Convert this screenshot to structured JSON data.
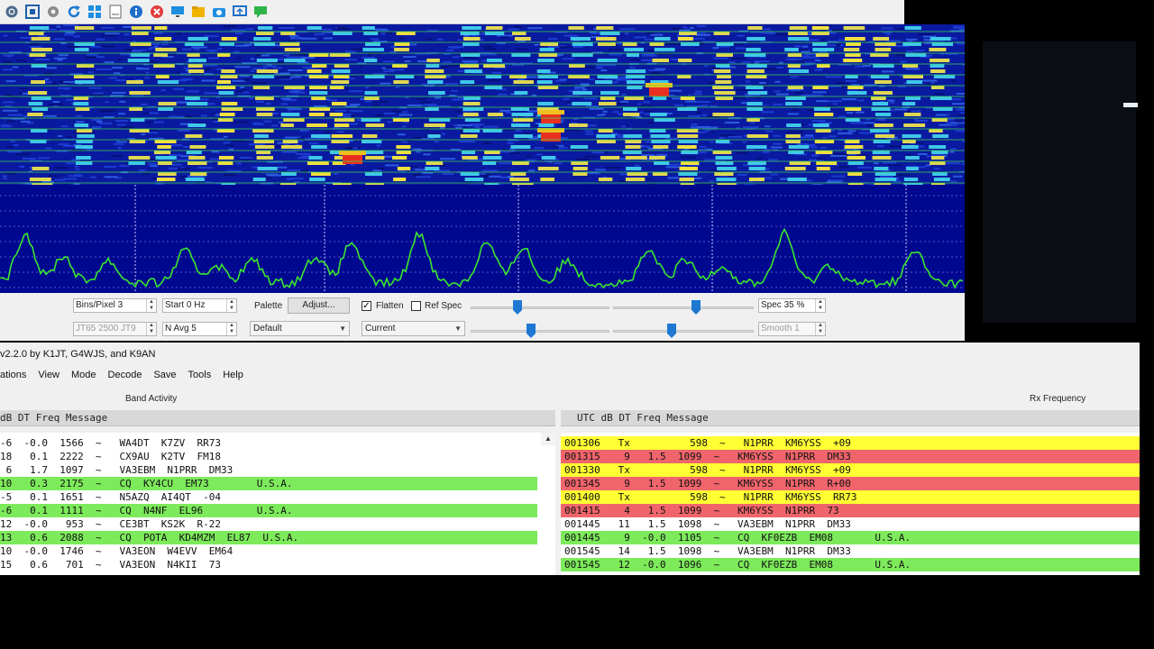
{
  "toolbar": {
    "icons": [
      "gear-network-icon",
      "expand-icon",
      "settings-icon",
      "refresh-icon",
      "windows-icon",
      "document-icon",
      "info-icon",
      "close-red-icon",
      "monitor-icon",
      "folder-icon",
      "camera-icon",
      "screen-share-icon",
      "chat-icon"
    ]
  },
  "controls": {
    "bins_pixel": "Bins/Pixel  3",
    "start": "Start 0 Hz",
    "palette_label": "Palette",
    "adjust_label": "Adjust...",
    "flatten_label": "Flatten",
    "ref_spec_label": "Ref Spec",
    "spec": "Spec 35 %",
    "jt_setting": "JT65  2500  JT9",
    "n_avg": "N Avg 5",
    "palette_value": "Default",
    "spectrum_value": "Current",
    "smooth": "Smooth  1"
  },
  "window": {
    "title": "v2.2.0   by K1JT, G4WJS, and K9AN",
    "menu": [
      "ations",
      "View",
      "Mode",
      "Decode",
      "Save",
      "Tools",
      "Help"
    ]
  },
  "band_activity": {
    "title": "Band Activity",
    "header": "dB   DT  Freq    Message",
    "rows": [
      {
        "text": "-6  -0.0  1566  ~   WA4DT  K7ZV  RR73",
        "color": "#ffffff"
      },
      {
        "text": "18   0.1  2222  ~   CX9AU  K2TV  FM18",
        "color": "#ffffff"
      },
      {
        "text": " 6   1.7  1097  ~   VA3EBM  N1PRR  DM33",
        "color": "#ffffff"
      },
      {
        "text": "10   0.3  2175  ~   CQ  KY4CU  EM73        U.S.A.",
        "color": "#7dea5b"
      },
      {
        "text": "-5   0.1  1651  ~   N5AZQ  AI4QT  -04",
        "color": "#ffffff"
      },
      {
        "text": "-6   0.1  1111  ~   CQ  N4NF  EL96         U.S.A.",
        "color": "#7dea5b"
      },
      {
        "text": "12  -0.0   953  ~   CE3BT  KS2K  R-22",
        "color": "#ffffff"
      },
      {
        "text": "13   0.6  2088  ~   CQ  POTA  KD4MZM  EL87  U.S.A.",
        "color": "#7dea5b"
      },
      {
        "text": "10  -0.0  1746  ~   VA3EON  W4EVV  EM64",
        "color": "#ffffff"
      },
      {
        "text": "15   0.6   701  ~   VA3EON  N4KII  73",
        "color": "#ffffff"
      }
    ]
  },
  "rx_frequency": {
    "title": "Rx Frequency",
    "header": "UTC    dB   DT  Freq    Message",
    "rows": [
      {
        "text": "001306   Tx          598  ~   N1PRR  KM6YSS  +09",
        "color": "#ffff33"
      },
      {
        "text": "001315    9   1.5  1099  ~   KM6YSS  N1PRR  DM33",
        "color": "#f0656b"
      },
      {
        "text": "001330   Tx          598  ~   N1PRR  KM6YSS  +09",
        "color": "#ffff33"
      },
      {
        "text": "001345    9   1.5  1099  ~   KM6YSS  N1PRR  R+00",
        "color": "#f0656b"
      },
      {
        "text": "001400   Tx          598  ~   N1PRR  KM6YSS  RR73",
        "color": "#ffff33"
      },
      {
        "text": "001415    4   1.5  1099  ~   KM6YSS  N1PRR  73",
        "color": "#f0656b"
      },
      {
        "text": "001445   11   1.5  1098  ~   VA3EBM  N1PRR  DM33",
        "color": "#ffffff"
      },
      {
        "text": "001445    9  -0.0  1105  ~   CQ  KF0EZB  EM08       U.S.A.",
        "color": "#7dea5b"
      },
      {
        "text": "001545   14   1.5  1098  ~   VA3EBM  N1PRR  DM33",
        "color": "#ffffff"
      },
      {
        "text": "001545   12  -0.0  1096  ~   CQ  KF0EZB  EM08       U.S.A.",
        "color": "#7dea5b"
      }
    ]
  }
}
